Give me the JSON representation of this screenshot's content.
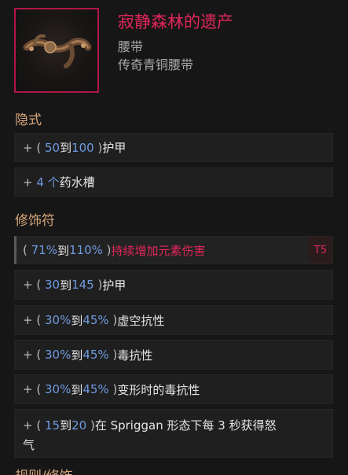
{
  "item": {
    "name": "寂静森林的遗产",
    "type": "腰带",
    "base": "传奇青铜腰带",
    "icon": "bronze-belt-icon",
    "border_color": "#b01646"
  },
  "sections": {
    "implicit_title": "隐式",
    "affix_title": "修饰符",
    "next_title_partial": "规则/修饰"
  },
  "implicits": [
    {
      "prefix": "+ (",
      "min": "50",
      "sep": "到",
      "max": "100",
      "suffix": ")",
      "stat": "护甲"
    },
    {
      "prefix": "+",
      "count": "4 个",
      "stat": "药水槽"
    }
  ],
  "affixes": [
    {
      "prefix": "(",
      "min": "71%",
      "sep": "到",
      "max": "110%",
      "suffix": ")",
      "stat": "持续增加元素伤害",
      "tier": "T5"
    },
    {
      "prefix": "+ (",
      "min": "30",
      "sep": "到",
      "max": "145",
      "suffix": ")",
      "stat": "护甲"
    },
    {
      "prefix": "+ (",
      "min": "30%",
      "sep": "到",
      "max": "45%",
      "suffix": ")",
      "stat": "虚空抗性"
    },
    {
      "prefix": "+ (",
      "min": "30%",
      "sep": "到",
      "max": "45%",
      "suffix": ")",
      "stat": "毒抗性"
    },
    {
      "prefix": "+ (",
      "min": "30%",
      "sep": "到",
      "max": "45%",
      "suffix": ")",
      "stat": "变形时的毒抗性"
    },
    {
      "prefix": "+ (",
      "min": "15",
      "sep": "到",
      "max": "20",
      "suffix": ")",
      "stat_line1": "在 Spriggan 形态下每 3 秒获得怒",
      "stat_line2": "气"
    }
  ],
  "colors": {
    "legendary": "#e3265a",
    "value": "#6f9ae0",
    "section": "#d6a77a",
    "background": "#161616"
  }
}
